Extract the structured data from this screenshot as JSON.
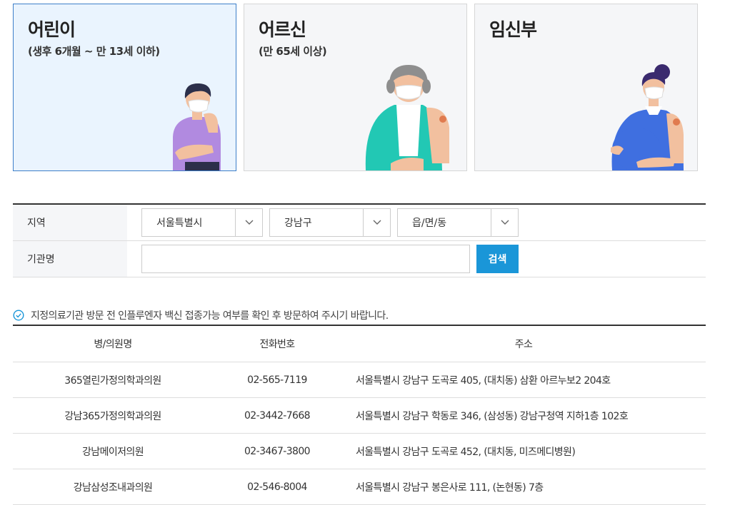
{
  "categories": [
    {
      "title": "어린이",
      "subtitle": "(생후 6개월 ~ 만 13세 이하)",
      "active": true
    },
    {
      "title": "어르신",
      "subtitle": "(만 65세 이상)",
      "active": false
    },
    {
      "title": "임신부",
      "subtitle": "",
      "active": false
    }
  ],
  "search": {
    "region_label": "지역",
    "region_selects": [
      "서울특별시",
      "강남구",
      "읍/면/동"
    ],
    "institution_label": "기관명",
    "institution_value": "",
    "search_button": "검색"
  },
  "notice": "지정의료기관 방문 전 인플루엔자 백신 접종가능 여부를 확인 후 방문하여 주시기 바랍니다.",
  "table": {
    "headers": [
      "병/의원명",
      "전화번호",
      "주소"
    ],
    "rows": [
      {
        "name": "365열린가정의학과의원",
        "phone": "02-565-7119",
        "address": "서울특별시 강남구 도곡로 405, (대치동) 삼환 아르누보2 204호"
      },
      {
        "name": "강남365가정의학과의원",
        "phone": "02-3442-7668",
        "address": "서울특별시 강남구 학동로 346, (삼성동) 강남구청역 지하1층 102호"
      },
      {
        "name": "강남메이저의원",
        "phone": "02-3467-3800",
        "address": "서울특별시 강남구 도곡로 452, (대치동, 미즈메디병원)"
      },
      {
        "name": "강남삼성조내과의원",
        "phone": "02-546-8004",
        "address": "서울특별시 강남구 봉은사로 111, (논현동) 7층"
      }
    ]
  },
  "colors": {
    "accent": "#1a96d8",
    "active_card_border": "#3d7fc9",
    "active_card_bg": "#eaf4fe"
  }
}
